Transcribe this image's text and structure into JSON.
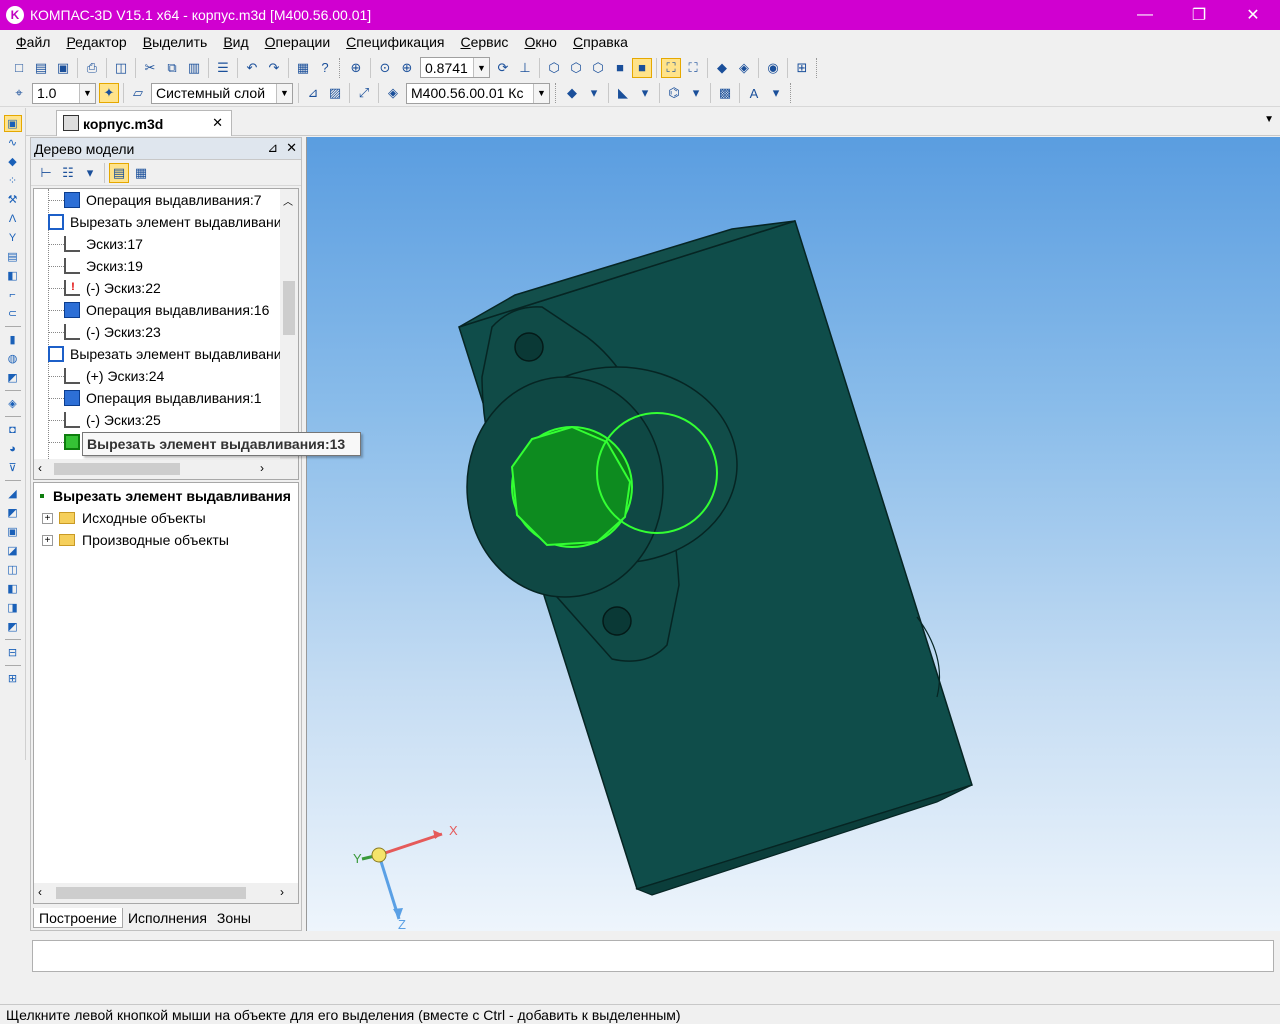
{
  "window": {
    "title": "КОМПАС-3D V15.1 x64 - корпус.m3d [M400.56.00.01]",
    "minimize": "—",
    "maximize": "❐",
    "close": "✕"
  },
  "menu": [
    {
      "first": "Ф",
      "rest": "айл"
    },
    {
      "first": "Р",
      "rest": "едактор"
    },
    {
      "first": "В",
      "rest": "ыделить"
    },
    {
      "first": "В",
      "rest": "ид"
    },
    {
      "first": "О",
      "rest": "перации"
    },
    {
      "first": "С",
      "rest": "пецификация"
    },
    {
      "first": "С",
      "rest": "ервис"
    },
    {
      "first": "О",
      "rest": "кно"
    },
    {
      "first": "С",
      "rest": "правка"
    }
  ],
  "toolbar": {
    "zoom_value": "0.8741",
    "step_value": "1.0",
    "layer_value": "Системный слой",
    "designation_value": "M400.56.00.01 Кс"
  },
  "document_tab": {
    "label": "корпус.m3d",
    "close": "✕"
  },
  "model_tree": {
    "header": "Дерево модели",
    "pin": "⊿",
    "close": "✕",
    "items": [
      {
        "label": "Операция выдавливания:7",
        "icon": "extrude-icon"
      },
      {
        "label": "Вырезать элемент выдавливания",
        "icon": "cut-extrude-icon"
      },
      {
        "label": "Эскиз:17",
        "icon": "sketch-icon"
      },
      {
        "label": "Эскиз:19",
        "icon": "sketch-icon"
      },
      {
        "label": "(-) Эскиз:22",
        "icon": "sketch-error-icon"
      },
      {
        "label": "Операция выдавливания:16",
        "icon": "extrude-icon"
      },
      {
        "label": "(-) Эскиз:23",
        "icon": "sketch-icon"
      },
      {
        "label": "Вырезать элемент выдавливания",
        "icon": "cut-extrude-icon"
      },
      {
        "label": "(+) Эскиз:24",
        "icon": "sketch-icon"
      },
      {
        "label": "Операция выдавливания:1",
        "icon": "extrude-icon"
      },
      {
        "label": "(-) Эскиз:25",
        "icon": "sketch-icon"
      },
      {
        "label": "",
        "icon": "cut-extrude-selected-icon"
      }
    ],
    "tooltip": "Вырезать элемент выдавливания:13"
  },
  "properties": {
    "selected": "Вырезать элемент выдавливания",
    "children": [
      "Исходные объекты",
      "Производные объекты"
    ]
  },
  "panel_tabs": [
    "Построение",
    "Исполнения",
    "Зоны"
  ],
  "axes": {
    "x": "X",
    "y": "Y",
    "z": "Z"
  },
  "status_text": "Щелкните левой кнопкой мыши на объекте для его выделения (вместе с Ctrl - добавить к выделенным)",
  "colors": {
    "title_bar": "#d000d0",
    "model_body": "#0f4d4a",
    "selection": "#33ff33"
  }
}
